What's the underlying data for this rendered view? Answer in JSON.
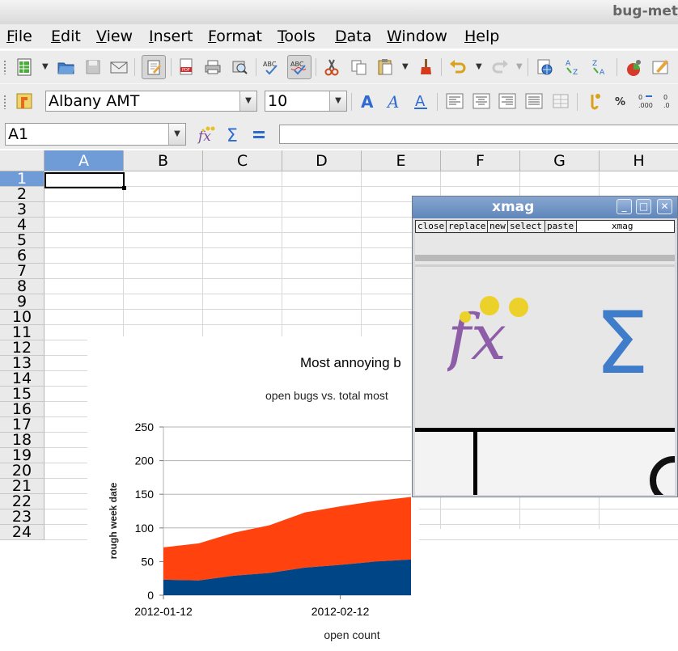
{
  "window": {
    "title": "bug-met"
  },
  "menu": [
    "File",
    "Edit",
    "View",
    "Insert",
    "Format",
    "Tools",
    "Data",
    "Window",
    "Help"
  ],
  "format_toolbar": {
    "font_name": "Albany AMT",
    "font_size": "10"
  },
  "formula_bar": {
    "name_box": "A1",
    "formula": ""
  },
  "sheet": {
    "columns": [
      "A",
      "B",
      "C",
      "D",
      "E",
      "F",
      "G",
      "H"
    ],
    "rows": [
      "1",
      "2",
      "3",
      "4",
      "5",
      "6",
      "7",
      "8",
      "9",
      "10",
      "11",
      "12",
      "13",
      "14",
      "15",
      "16",
      "17",
      "18",
      "19",
      "20",
      "21",
      "22",
      "23",
      "24"
    ],
    "active_cell": "A1"
  },
  "chart": {
    "title": "Most annoying b",
    "subtitle": "open bugs vs. total most",
    "xlabel": "open count",
    "ylabel": "rough week date",
    "y_ticks": [
      "0",
      "50",
      "100",
      "150",
      "200",
      "250"
    ],
    "x_ticks": [
      "2012-01-12",
      "2012-02-12"
    ]
  },
  "chart_data": {
    "type": "area",
    "title": "Most annoying b",
    "subtitle": "open bugs vs. total most",
    "xlabel": "open count",
    "ylabel": "rough week date",
    "ylim": [
      0,
      250
    ],
    "x": [
      "2012-01-12",
      "2012-01-19",
      "2012-01-26",
      "2012-02-02",
      "2012-02-09",
      "2012-02-16",
      "2012-02-23",
      "2012-03-01"
    ],
    "series": [
      {
        "color": "#004586",
        "values": [
          23,
          22,
          29,
          33,
          41,
          45,
          50,
          53
        ]
      },
      {
        "color": "#ff420e",
        "values": [
          48,
          55,
          64,
          71,
          82,
          87,
          90,
          93
        ]
      }
    ],
    "stacked": true,
    "grid": true,
    "x_tick_labels": [
      "2012-01-12",
      "2012-02-12"
    ]
  },
  "xmag": {
    "title": "xmag",
    "buttons": [
      "close",
      "replace",
      "new",
      "select",
      "paste"
    ],
    "label": "xmag"
  },
  "colors": {
    "selection": "#6f9bd6",
    "series1": "#004586",
    "series2": "#ff420e",
    "xmag_title": "#6f93c6"
  }
}
